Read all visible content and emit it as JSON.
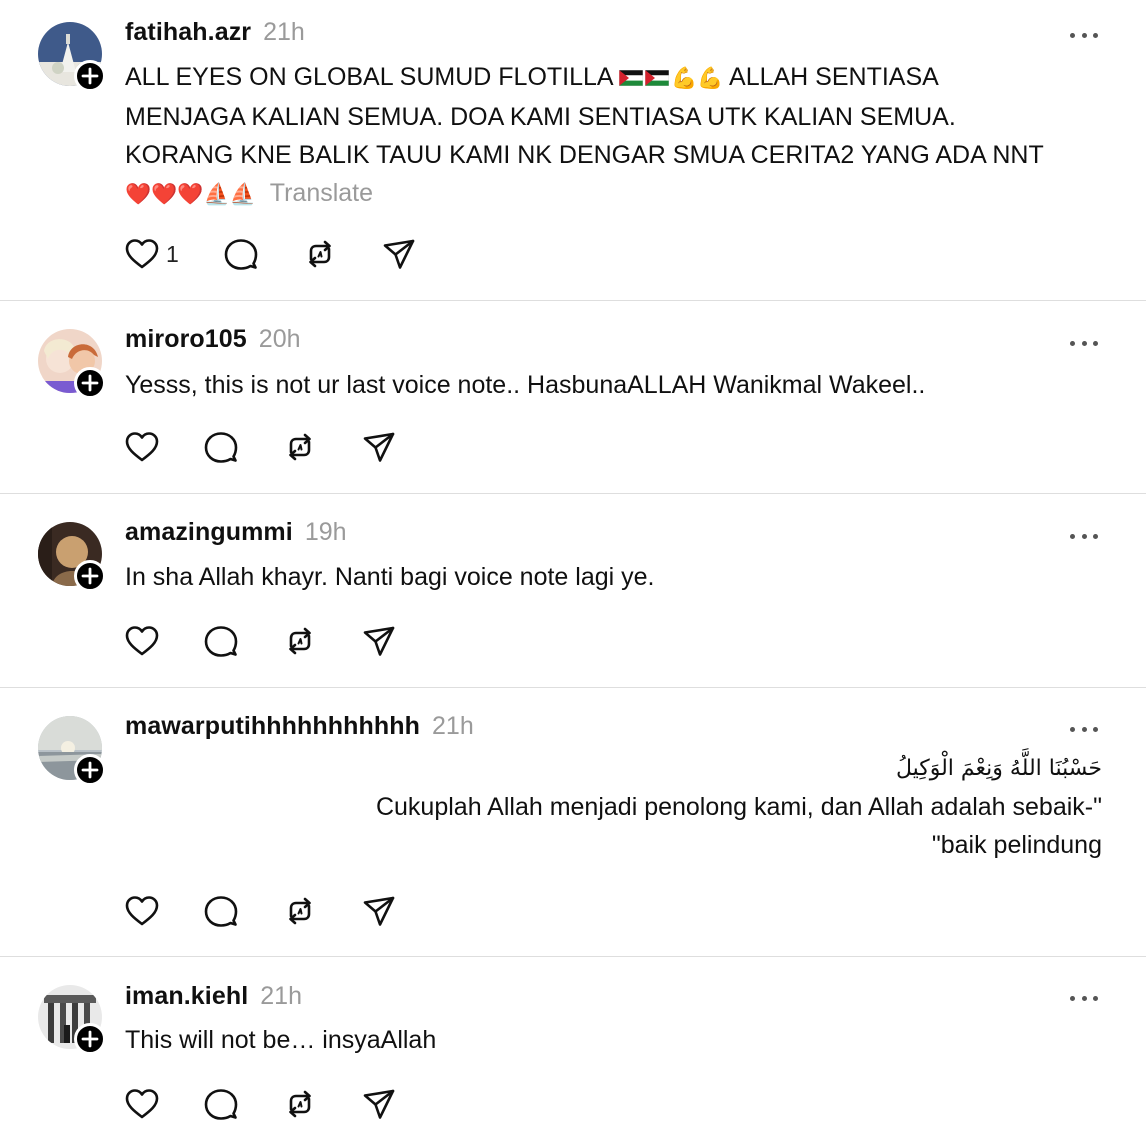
{
  "posts": [
    {
      "username": "fatihah.azr",
      "time": "21h",
      "line1_a": "ALL EYES ON GLOBAL SUMUD FLOTILLA ",
      "line1_emoji": "💪💪",
      "line1_b": " ALLAH SENTIASA",
      "line2": "MENJAGA KALIAN SEMUA. DOA KAMI SENTIASA UTK KALIAN SEMUA.",
      "line3": "KORANG KNE BALIK TAUU KAMI NK DENGAR SMUA CERITA2 YANG ADA NNT",
      "line4_emoji": "❤️❤️❤️⛵⛵",
      "translate": "Translate",
      "likes": "1"
    },
    {
      "username": "miroro105",
      "time": "20h",
      "text": "Yesss, this is not ur last voice note.. HasbunaALLAH Wanikmal Wakeel.."
    },
    {
      "username": "amazingummi",
      "time": "19h",
      "text": "In sha Allah khayr. Nanti bagi voice note lagi ye."
    },
    {
      "username": "mawarputihhhhhhhhhhh",
      "time": "21h",
      "arabic": "حَسْبُنَا اللَّهُ وَنِعْمَ الْوَكِيلُ",
      "line2": "Cukuplah Allah menjadi penolong kami, dan Allah adalah sebaik-\"",
      "line3": "\"baik pelindung"
    },
    {
      "username": "iman.kiehl",
      "time": "21h",
      "text": "This will not be… insyaAllah"
    }
  ],
  "icons": [
    "heart-icon",
    "comment-icon",
    "repost-icon",
    "share-icon",
    "more-icon",
    "follow-plus-icon"
  ],
  "colors": {
    "text": "#101010",
    "muted": "#9a9a9a",
    "divider": "#dedede",
    "badge": "#000000"
  }
}
